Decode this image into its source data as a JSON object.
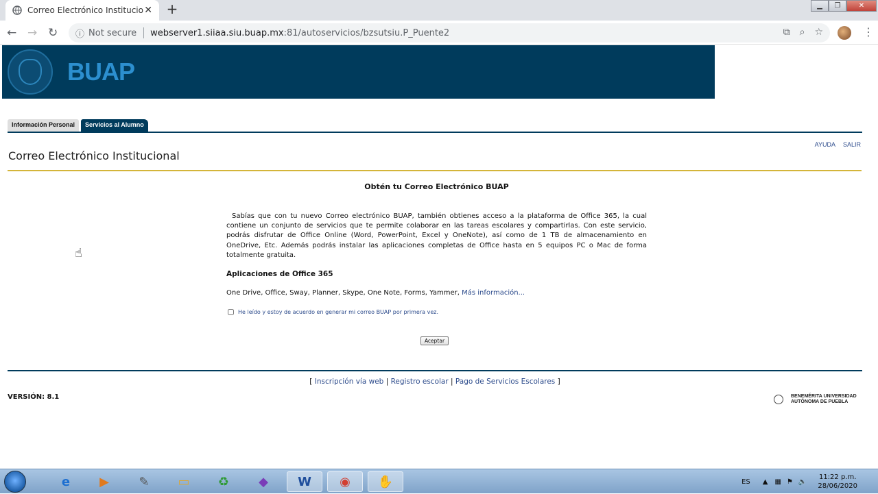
{
  "browser": {
    "tab_title": "Correo Electrónico Institucional",
    "tab_close": "✕",
    "new_tab": "+",
    "security_label": "Not secure",
    "url_host": "webserver1.siiaa.siu.buap.mx",
    "url_path": ":81/autoservicios/bzsutsiu.P_Puente2"
  },
  "banner": {
    "logo_text": "BUAP"
  },
  "tabs": [
    {
      "label": "Información Personal"
    },
    {
      "label": "Servicios al Alumno"
    }
  ],
  "top_links": {
    "help": "AYUDA",
    "exit": "SALIR"
  },
  "page": {
    "title": "Correo Electrónico Institucional",
    "heading": "Obtén tu Correo Electrónico BUAP",
    "paragraph": "Sabías que con tu nuevo Correo electrónico BUAP, también obtienes acceso a la plataforma de Office 365, la cual contiene un conjunto de servicios que te permite colaborar en las tareas escolares y compartirlas. Con este servicio, podrás disfrutar de Office Online (Word, PowerPoint, Excel y OneNote), así como de 1 TB de almacenamiento en OneDrive, Etc. Además podrás instalar las aplicaciones completas de Office hasta en 5 equipos PC o Mac de forma totalmente gratuita.",
    "apps_heading": "Aplicaciones de Office 365",
    "apps_list": "One Drive, Office, Sway, Planner, Skype, One Note, Forms, Yammer,",
    "more_info": "Más información...",
    "agree_label": "He leído y estoy de acuerdo en generar mi correo BUAP por primera vez.",
    "accept_button": "Aceptar"
  },
  "footer": {
    "open_bracket": "[",
    "link1": "Inscripción vía web",
    "sep": "|",
    "link2": "Registro escolar",
    "link3": "Pago de Servicios Escolares",
    "close_bracket": "]",
    "version": "VERSIÓN: 8.1",
    "univ_line1": "BENEMÉRITA UNIVERSIDAD",
    "univ_line2": "AUTÓNOMA DE PUEBLA"
  },
  "taskbar": {
    "lang": "ES",
    "time": "11:22 p.m.",
    "date": "28/06/2020"
  },
  "colors": {
    "banner": "#003b5c",
    "logo_blue": "#2c8fcf",
    "gold_rule": "#d4b53a",
    "link": "#2b4a8b"
  }
}
